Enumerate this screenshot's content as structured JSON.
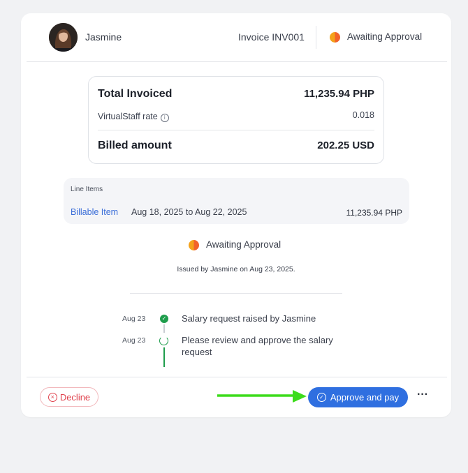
{
  "header": {
    "user_name": "Jasmine",
    "invoice_label": "Invoice INV001",
    "status": "Awaiting Approval"
  },
  "summary": {
    "total_invoiced_label": "Total Invoiced",
    "total_invoiced_value": "11,235.94 PHP",
    "rate_label": "VirtualStaff rate",
    "rate_value": "0.018",
    "billed_label": "Billed amount",
    "billed_value": "202.25 USD"
  },
  "line_items": {
    "title": "Line Items",
    "items": [
      {
        "name": "Billable Item",
        "dates": "Aug 18, 2025 to Aug 22, 2025",
        "amount": "11,235.94 PHP"
      }
    ]
  },
  "status_block": {
    "status": "Awaiting Approval",
    "issued_text": "Issued by Jasmine on Aug 23, 2025."
  },
  "timeline": [
    {
      "date": "Aug 23",
      "text": "Salary request raised by Jasmine",
      "state": "done"
    },
    {
      "date": "Aug 23",
      "text": "Please review and approve the salary request",
      "state": "pending"
    }
  ],
  "footer": {
    "decline_label": "Decline",
    "approve_label": "Approve and pay",
    "more_label": "···"
  },
  "colors": {
    "primary": "#2f6fe0",
    "decline": "#e0434e",
    "success": "#1f9d4c",
    "annotation_arrow": "#3ddc1c"
  }
}
